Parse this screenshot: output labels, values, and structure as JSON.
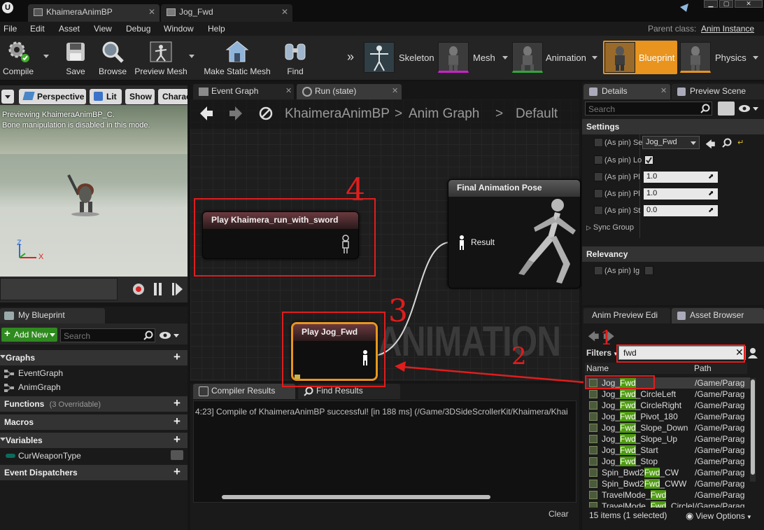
{
  "titlebar": {
    "tabs": [
      {
        "label": "KhaimeraAnimBP",
        "close": "✕"
      },
      {
        "label": "Jog_Fwd",
        "close": "✕"
      }
    ]
  },
  "menubar": {
    "items": [
      "File",
      "Edit",
      "Asset",
      "View",
      "Debug",
      "Window",
      "Help"
    ],
    "parent_class_label": "Parent class:",
    "parent_class_value": "Anim Instance"
  },
  "toolbar": {
    "buttons": [
      "Compile",
      "Save",
      "Browse",
      "Preview Mesh",
      "Make Static Mesh",
      "Find"
    ],
    "modes": [
      "Skeleton",
      "Mesh",
      "Animation",
      "Blueprint",
      "Physics"
    ]
  },
  "viewport": {
    "buttons": [
      "Perspective",
      "Lit",
      "Show",
      "Charac"
    ],
    "info_line1": "Previewing KhaimeraAnimBP_C.",
    "info_line2": "Bone manipulation is disabled in this mode.",
    "axis_z": "Z",
    "axis_x": "X"
  },
  "my_blueprint": {
    "tab": "My Blueprint",
    "add_new": "Add New",
    "search_placeholder": "Search",
    "graphs_header": "Graphs",
    "graphs": [
      "EventGraph",
      "AnimGraph"
    ],
    "functions_header": "Functions",
    "functions_count": "(3 Overridable)",
    "macros_header": "Macros",
    "variables_header": "Variables",
    "variables": [
      "CurWeaponType"
    ],
    "dispatchers_header": "Event Dispatchers"
  },
  "graph": {
    "tabs": [
      "Event Graph",
      "Run (state)"
    ],
    "breadcrumb": [
      "KhaimeraAnimBP",
      "Anim Graph",
      "Default"
    ],
    "watermark": "ANIMATION",
    "nodes": {
      "final_pose_title": "Final Animation Pose",
      "final_pose_pin": "Result",
      "play_run_title": "Play Khaimera_run_with_sword",
      "play_jog_title": "Play Jog_Fwd"
    }
  },
  "annotations": [
    "1",
    "2",
    "3",
    "4"
  ],
  "compiler": {
    "tabs": [
      "Compiler Results",
      "Find Results"
    ],
    "log": "4:23] Compile of KhaimeraAnimBP successful! [in 188 ms] (/Game/3DSideScrollerKit/Khaimera/Khai",
    "clear": "Clear"
  },
  "details": {
    "tabs": [
      "Details",
      "Preview Scene"
    ],
    "search_placeholder": "Search",
    "settings_header": "Settings",
    "rows": [
      {
        "label": "(As pin) Se",
        "value": "Jog_Fwd"
      },
      {
        "label": "(As pin) Lo",
        "value": "true"
      },
      {
        "label": "(As pin) Pl",
        "value": "1.0"
      },
      {
        "label": "(As pin) Pl",
        "value": "1.0"
      },
      {
        "label": "(As pin) St",
        "value": "0.0"
      }
    ],
    "sync_group": "Sync Group",
    "relevancy_header": "Relevancy",
    "relevancy_row": "(As pin) Ig"
  },
  "asset_browser": {
    "tabs": [
      "Anim Preview Edi",
      "Asset Browser"
    ],
    "filters": "Filters",
    "search_value": "fwd",
    "col_name": "Name",
    "col_path": "Path",
    "rows": [
      {
        "pre": "Jog_",
        "hl": "Fwd",
        "post": "",
        "path": "/Game/Parag"
      },
      {
        "pre": "Jog_",
        "hl": "Fwd",
        "post": "_CircleLeft",
        "path": "/Game/Parag"
      },
      {
        "pre": "Jog_",
        "hl": "Fwd",
        "post": "_CircleRight",
        "path": "/Game/Parag"
      },
      {
        "pre": "Jog_",
        "hl": "Fwd",
        "post": "_Pivot_180",
        "path": "/Game/Parag"
      },
      {
        "pre": "Jog_",
        "hl": "Fwd",
        "post": "_Slope_Down",
        "path": "/Game/Parag"
      },
      {
        "pre": "Jog_",
        "hl": "Fwd",
        "post": "_Slope_Up",
        "path": "/Game/Parag"
      },
      {
        "pre": "Jog_",
        "hl": "Fwd",
        "post": "_Start",
        "path": "/Game/Parag"
      },
      {
        "pre": "Jog_",
        "hl": "Fwd",
        "post": "_Stop",
        "path": "/Game/Parag"
      },
      {
        "pre": "Spin_Bwd2",
        "hl": "Fwd",
        "post": "_CW",
        "path": "/Game/Parag"
      },
      {
        "pre": "Spin_Bwd2",
        "hl": "Fwd",
        "post": "_CWW",
        "path": "/Game/Parag"
      },
      {
        "pre": "TravelMode_",
        "hl": "Fwd",
        "post": "",
        "path": "/Game/Parag"
      },
      {
        "pre": "TravelMode_",
        "hl": "Fwd",
        "post": "_CircleL",
        "path": "/Game/Parag"
      }
    ],
    "status": "15 items (1 selected)",
    "view_options": "View Options"
  }
}
